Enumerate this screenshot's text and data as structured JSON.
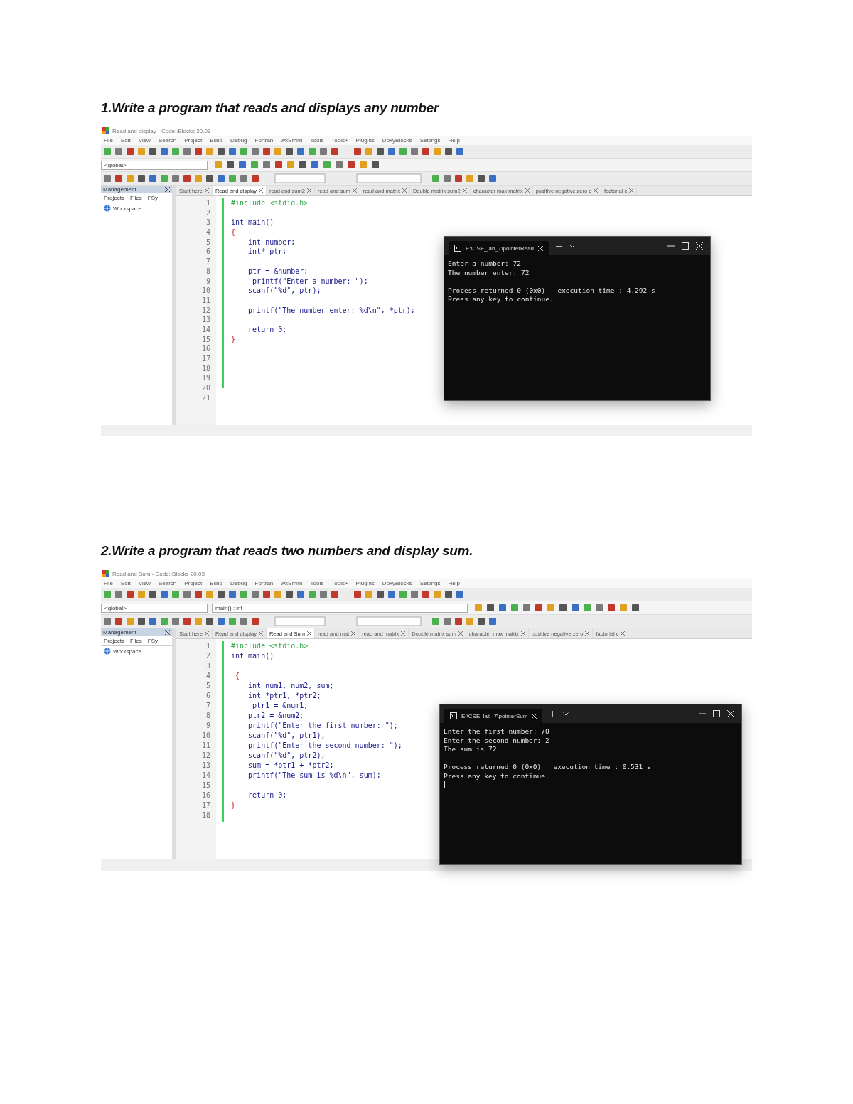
{
  "sections": [
    {
      "heading": "1.Write a program that reads and displays any number",
      "ide": {
        "title": "Read and display - Code::Blocks 20.03",
        "menu": [
          "File",
          "Edit",
          "View",
          "Search",
          "Project",
          "Build",
          "Debug",
          "Fortran",
          "wxSmith",
          "Tools",
          "Tools+",
          "Plugins",
          "DoxyBlocks",
          "Settings",
          "Help"
        ],
        "dropdowns": [
          "<global>"
        ],
        "management": {
          "title": "Management",
          "tabs": [
            "Projects",
            "Files",
            "FSy"
          ],
          "tree_item": "Workspace"
        },
        "tabs": [
          {
            "label": "Start here",
            "selected": false
          },
          {
            "label": "Read and display",
            "selected": true
          },
          {
            "label": "read and sum2",
            "selected": false
          },
          {
            "label": "read and sum",
            "selected": false
          },
          {
            "label": "read and matrix",
            "selected": false
          },
          {
            "label": "Double matrix sum2",
            "selected": false
          },
          {
            "label": "character max matrix",
            "selected": false
          },
          {
            "label": "positive negative zero c",
            "selected": false
          },
          {
            "label": "factorial c",
            "selected": false
          }
        ],
        "lines": [
          {
            "n": "1",
            "kind": "preprocessor",
            "code": "#include <stdio.h>"
          },
          {
            "n": "2"
          },
          {
            "n": "3",
            "kind": "code",
            "code": "int main()"
          },
          {
            "n": "4",
            "kind": "brace",
            "code": "{"
          },
          {
            "n": "5",
            "kind": "code",
            "code": "    int number;"
          },
          {
            "n": "6",
            "kind": "code",
            "code": "    int* ptr;"
          },
          {
            "n": "7"
          },
          {
            "n": "8",
            "kind": "code",
            "code": "    ptr = &number;"
          },
          {
            "n": "9",
            "kind": "code",
            "code": "     printf(\"Enter a number: \");"
          },
          {
            "n": "10",
            "kind": "code",
            "code": "    scanf(\"%d\", ptr);"
          },
          {
            "n": "11"
          },
          {
            "n": "12",
            "kind": "code",
            "code": "    printf(\"The number enter: %d\\n\", *ptr);"
          },
          {
            "n": "13"
          },
          {
            "n": "14",
            "kind": "code",
            "code": "    return 0;"
          },
          {
            "n": "15",
            "kind": "brace",
            "code": "}"
          },
          {
            "n": "16"
          },
          {
            "n": "17"
          },
          {
            "n": "18"
          },
          {
            "n": "19"
          },
          {
            "n": "20"
          },
          {
            "n": "21"
          }
        ],
        "console": {
          "title": "E:\\CSE_lab_7\\pointerRead",
          "blocks": [
            [
              "Enter a number: 72",
              "The number enter: 72"
            ],
            [
              "Process returned 0 (0x0)   execution time : 4.292 s",
              "Press any key to continue."
            ]
          ],
          "cursor": false
        }
      }
    },
    {
      "heading": "2.Write a program that reads two numbers and display sum.",
      "ide": {
        "title": "Read and Sum - Code::Blocks 20.03",
        "menu": [
          "File",
          "Edit",
          "View",
          "Search",
          "Project",
          "Build",
          "Debug",
          "Fortran",
          "wxSmith",
          "Tools",
          "Tools+",
          "Plugins",
          "DoxyBlocks",
          "Settings",
          "Help"
        ],
        "dropdowns": [
          "<global>",
          "main() : int"
        ],
        "management": {
          "title": "Management",
          "tabs": [
            "Projects",
            "Files",
            "FSy"
          ],
          "tree_item": "Workspace"
        },
        "tabs": [
          {
            "label": "Start here",
            "selected": false
          },
          {
            "label": "Read and display",
            "selected": false
          },
          {
            "label": "Read and Sum",
            "selected": true
          },
          {
            "label": "read and mat",
            "selected": false
          },
          {
            "label": "read and matrix",
            "selected": false
          },
          {
            "label": "Double matrix sum",
            "selected": false
          },
          {
            "label": "character max matrix",
            "selected": false
          },
          {
            "label": "positive negative zero",
            "selected": false
          },
          {
            "label": "factorial c",
            "selected": false
          }
        ],
        "lines": [
          {
            "n": "1",
            "kind": "preprocessor",
            "code": "#include <stdio.h>"
          },
          {
            "n": "2",
            "kind": "code",
            "code": "int main()"
          },
          {
            "n": "3"
          },
          {
            "n": "4",
            "kind": "brace",
            "code": " {"
          },
          {
            "n": "5",
            "kind": "code",
            "code": "    int num1, num2, sum;"
          },
          {
            "n": "6",
            "kind": "code",
            "code": "    int *ptr1, *ptr2;"
          },
          {
            "n": "7",
            "kind": "code",
            "code": "     ptr1 = &num1;"
          },
          {
            "n": "8",
            "kind": "code",
            "code": "    ptr2 = &num2;"
          },
          {
            "n": "9",
            "kind": "code",
            "code": "    printf(\"Enter the first number: \");"
          },
          {
            "n": "10",
            "kind": "code",
            "code": "    scanf(\"%d\", ptr1);"
          },
          {
            "n": "11",
            "kind": "code",
            "code": "    printf(\"Enter the second number: \");"
          },
          {
            "n": "12",
            "kind": "code",
            "code": "    scanf(\"%d\", ptr2);"
          },
          {
            "n": "13",
            "kind": "code",
            "code": "    sum = *ptr1 + *ptr2;"
          },
          {
            "n": "14",
            "kind": "code",
            "code": "    printf(\"The sum is %d\\n\", sum);"
          },
          {
            "n": "15"
          },
          {
            "n": "16",
            "kind": "code",
            "code": "    return 0;"
          },
          {
            "n": "17",
            "kind": "brace",
            "code": "}"
          },
          {
            "n": "18"
          }
        ],
        "console": {
          "title": "E:\\CSE_lab_7\\pointerSum",
          "blocks": [
            [
              "Enter the first number: 70",
              "Enter the second number: 2",
              "The sum is 72"
            ],
            [
              "Process returned 0 (0x0)   execution time : 0.531 s",
              "Press any key to continue."
            ]
          ],
          "cursor": true
        }
      }
    }
  ]
}
